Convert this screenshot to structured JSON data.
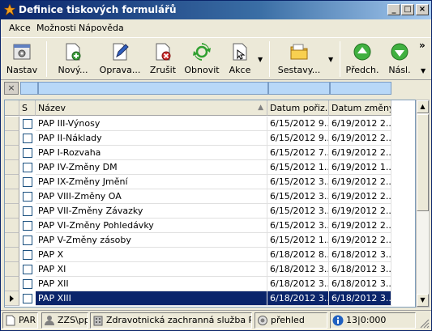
{
  "window": {
    "title": "Definice tiskových formulářů",
    "minimize": "_",
    "maximize": "□",
    "close": "×"
  },
  "menu": [
    "Akce",
    "Možnosti",
    "Nápověda"
  ],
  "toolbar": {
    "nastav": "Nastav",
    "novy": "Nový...",
    "oprava": "Oprava...",
    "zrusit": "Zrušit",
    "obnovit": "Obnovit",
    "akce": "Akce",
    "sestavy": "Sestavy...",
    "predch": "Předch.",
    "nasl": "Násl.",
    "overflow": "»"
  },
  "filter": {
    "clear": "×"
  },
  "grid": {
    "columns": {
      "s": "S",
      "nazev": "Název",
      "datum_porizeni": "Datum pořiz...",
      "datum_zmeny": "Datum změny"
    },
    "rows": [
      {
        "nazev": "PAP III-Výnosy",
        "datum_porizeni": "6/15/2012 9...",
        "datum_zmeny": "6/19/2012 2..."
      },
      {
        "nazev": "PAP II-Náklady",
        "datum_porizeni": "6/15/2012 9...",
        "datum_zmeny": "6/19/2012 2..."
      },
      {
        "nazev": "PAP I-Rozvaha",
        "datum_porizeni": "6/15/2012 7...",
        "datum_zmeny": "6/19/2012 2..."
      },
      {
        "nazev": "PAP IV-Změny DM",
        "datum_porizeni": "6/15/2012 1...",
        "datum_zmeny": "6/19/2012 1..."
      },
      {
        "nazev": "PAP IX-Změny Jmění",
        "datum_porizeni": "6/15/2012 3...",
        "datum_zmeny": "6/19/2012 2..."
      },
      {
        "nazev": "PAP VIII-Změny OA",
        "datum_porizeni": "6/15/2012 3...",
        "datum_zmeny": "6/19/2012 2..."
      },
      {
        "nazev": "PAP VII-Změny Závazky",
        "datum_porizeni": "6/15/2012 3...",
        "datum_zmeny": "6/19/2012 2..."
      },
      {
        "nazev": "PAP VI-Změny Pohledávky",
        "datum_porizeni": "6/15/2012 3...",
        "datum_zmeny": "6/19/2012 2..."
      },
      {
        "nazev": "PAP V-Změny zásoby",
        "datum_porizeni": "6/15/2012 1...",
        "datum_zmeny": "6/19/2012 2..."
      },
      {
        "nazev": "PAP X",
        "datum_porizeni": "6/18/2012 8...",
        "datum_zmeny": "6/18/2012 3..."
      },
      {
        "nazev": "PAP XI",
        "datum_porizeni": "6/18/2012 3...",
        "datum_zmeny": "6/18/2012 3..."
      },
      {
        "nazev": "PAP XII",
        "datum_porizeni": "6/18/2012 3...",
        "datum_zmeny": "6/18/2012 3..."
      },
      {
        "nazev": "PAP XIII",
        "datum_porizeni": "6/18/2012 3...",
        "datum_zmeny": "6/18/2012 3..."
      }
    ]
  },
  "status": {
    "par": "PAR",
    "zzs": "ZZS\\pp",
    "org": "Zdravotnická zachranná služba Pardu",
    "view": "přehled",
    "time": "13|0:000"
  }
}
